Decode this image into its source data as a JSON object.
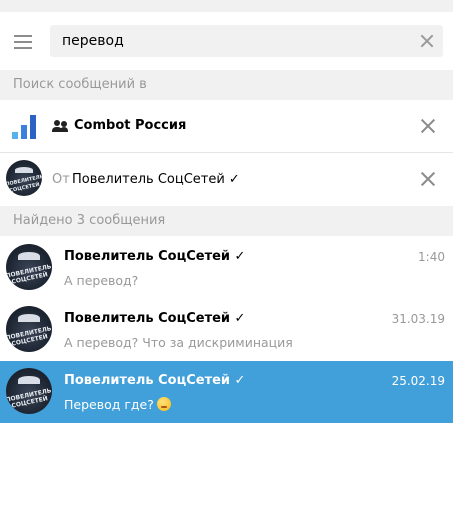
{
  "search": {
    "value": "перевод"
  },
  "sections": {
    "search_in": "Поиск сообщений в",
    "found": "Найдено 3 сообщения"
  },
  "filters": {
    "chat": {
      "name": "Combot Россия"
    },
    "from": {
      "label": "От",
      "name": "Повелитель СоцСетей ✓"
    }
  },
  "avatar_text": "ПОВЕЛИТЕЛЬ СОЦСЕТЕЙ",
  "results": [
    {
      "name": "Повелитель СоцСетей ✓",
      "date": "1:40",
      "text": "А перевод?",
      "selected": false
    },
    {
      "name": "Повелитель СоцСетей ✓",
      "date": "31.03.19",
      "text": "А перевод? Что за дискриминация",
      "selected": false
    },
    {
      "name": "Повелитель СоцСетей ✓",
      "date": "25.02.19",
      "text": "Перевод где?",
      "selected": true,
      "emoji": "face-icon"
    }
  ],
  "colors": {
    "accent": "#419fd9",
    "combot_blue": "#3c7fdc",
    "section_bg": "#f1f1f1"
  }
}
